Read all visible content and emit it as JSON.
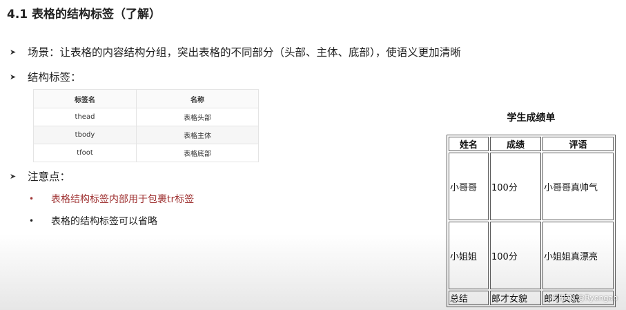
{
  "title": "4.1 表格的结构标签（了解）",
  "bullets": [
    "场景：让表格的内容结构分组，突出表格的不同部分（头部、主体、底部），使语义更加清晰",
    "结构标签：",
    "注意点："
  ],
  "tag_table": {
    "headers": [
      "标签名",
      "名称"
    ],
    "rows": [
      [
        "thead",
        "表格头部"
      ],
      [
        "tbody",
        "表格主体"
      ],
      [
        "tfoot",
        "表格底部"
      ]
    ]
  },
  "notes": [
    "表格结构标签内部用于包裹tr标签",
    "表格的结构标签可以省略"
  ],
  "score_table": {
    "caption": "学生成绩单",
    "headers": [
      "姓名",
      "成绩",
      "评语"
    ],
    "rows": [
      [
        "小哥哥",
        "100分",
        "小哥哥真帅气"
      ],
      [
        "小姐姐",
        "100分",
        "小姐姐真漂亮"
      ]
    ],
    "footer": [
      "总结",
      "郎才女貌",
      "郎才女貌"
    ]
  },
  "watermark": "CSDN @Ryongao",
  "colors": {
    "note_red": "#a03434"
  },
  "icons": {
    "bullet": "arrow-bullet-icon",
    "note": "dot-bullet-icon"
  }
}
